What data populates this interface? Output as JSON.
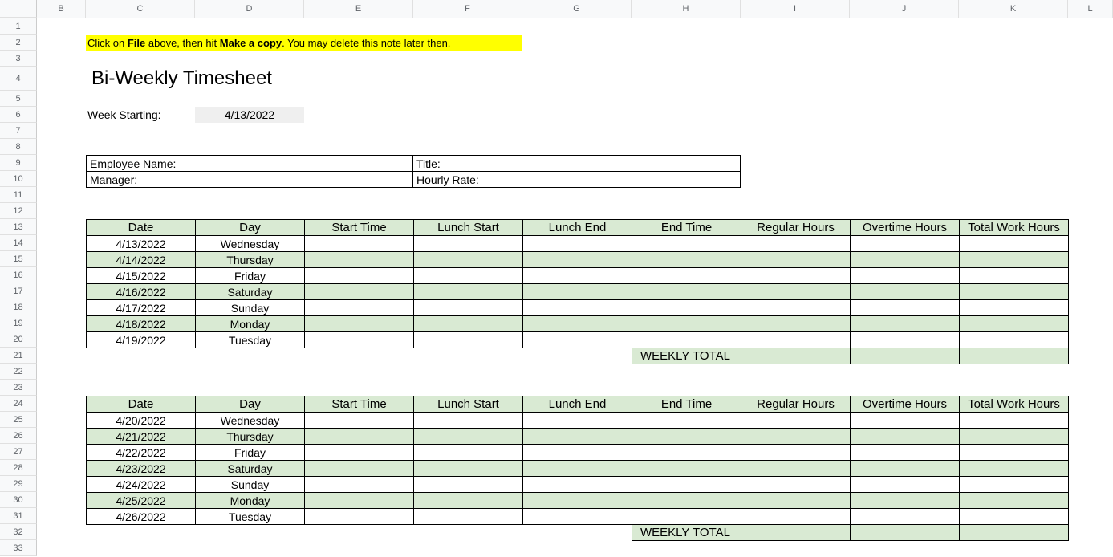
{
  "columns": [
    {
      "label": "B",
      "w": 61
    },
    {
      "label": "C",
      "w": 136
    },
    {
      "label": "D",
      "w": 136
    },
    {
      "label": "E",
      "w": 136
    },
    {
      "label": "F",
      "w": 136
    },
    {
      "label": "G",
      "w": 136
    },
    {
      "label": "H",
      "w": 136
    },
    {
      "label": "I",
      "w": 136
    },
    {
      "label": "J",
      "w": 136
    },
    {
      "label": "K",
      "w": 136
    },
    {
      "label": "L",
      "w": 56
    }
  ],
  "row_heights": {
    "1": 20,
    "2": 20,
    "3": 20,
    "4": 30,
    "5": 20,
    "6": 20,
    "7": 20,
    "8": 20,
    "9": 20,
    "10": 20,
    "11": 20,
    "12": 20,
    "13": 20,
    "14": 20,
    "15": 20,
    "16": 20,
    "17": 20,
    "18": 20,
    "19": 20,
    "20": 20,
    "21": 20,
    "22": 20,
    "23": 20,
    "24": 20,
    "25": 20,
    "26": 20,
    "27": 20,
    "28": 20,
    "29": 20,
    "30": 20,
    "31": 20,
    "32": 20,
    "33": 20
  },
  "note": {
    "prefix": "Click on ",
    "b1": "File",
    "mid": " above, then hit ",
    "b2": "Make a copy",
    "suffix": ". You may delete this note later then."
  },
  "title": "Bi-Weekly Timesheet",
  "week_starting_label": "Week Starting:",
  "week_starting_value": "4/13/2022",
  "info": {
    "emp_label": "Employee Name:",
    "title_label": "Title:",
    "mgr_label": "Manager:",
    "rate_label": "Hourly Rate:"
  },
  "headers": [
    "Date",
    "Day",
    "Start Time",
    "Lunch Start",
    "Lunch End",
    "End Time",
    "Regular Hours",
    "Overtime Hours",
    "Total Work Hours"
  ],
  "week1": [
    {
      "date": "4/13/2022",
      "day": "Wednesday"
    },
    {
      "date": "4/14/2022",
      "day": "Thursday"
    },
    {
      "date": "4/15/2022",
      "day": "Friday"
    },
    {
      "date": "4/16/2022",
      "day": "Saturday"
    },
    {
      "date": "4/17/2022",
      "day": "Sunday"
    },
    {
      "date": "4/18/2022",
      "day": "Monday"
    },
    {
      "date": "4/19/2022",
      "day": "Tuesday"
    }
  ],
  "week2": [
    {
      "date": "4/20/2022",
      "day": "Wednesday"
    },
    {
      "date": "4/21/2022",
      "day": "Thursday"
    },
    {
      "date": "4/22/2022",
      "day": "Friday"
    },
    {
      "date": "4/23/2022",
      "day": "Saturday"
    },
    {
      "date": "4/24/2022",
      "day": "Sunday"
    },
    {
      "date": "4/25/2022",
      "day": "Monday"
    },
    {
      "date": "4/26/2022",
      "day": "Tuesday"
    }
  ],
  "weekly_total": "WEEKLY TOTAL"
}
